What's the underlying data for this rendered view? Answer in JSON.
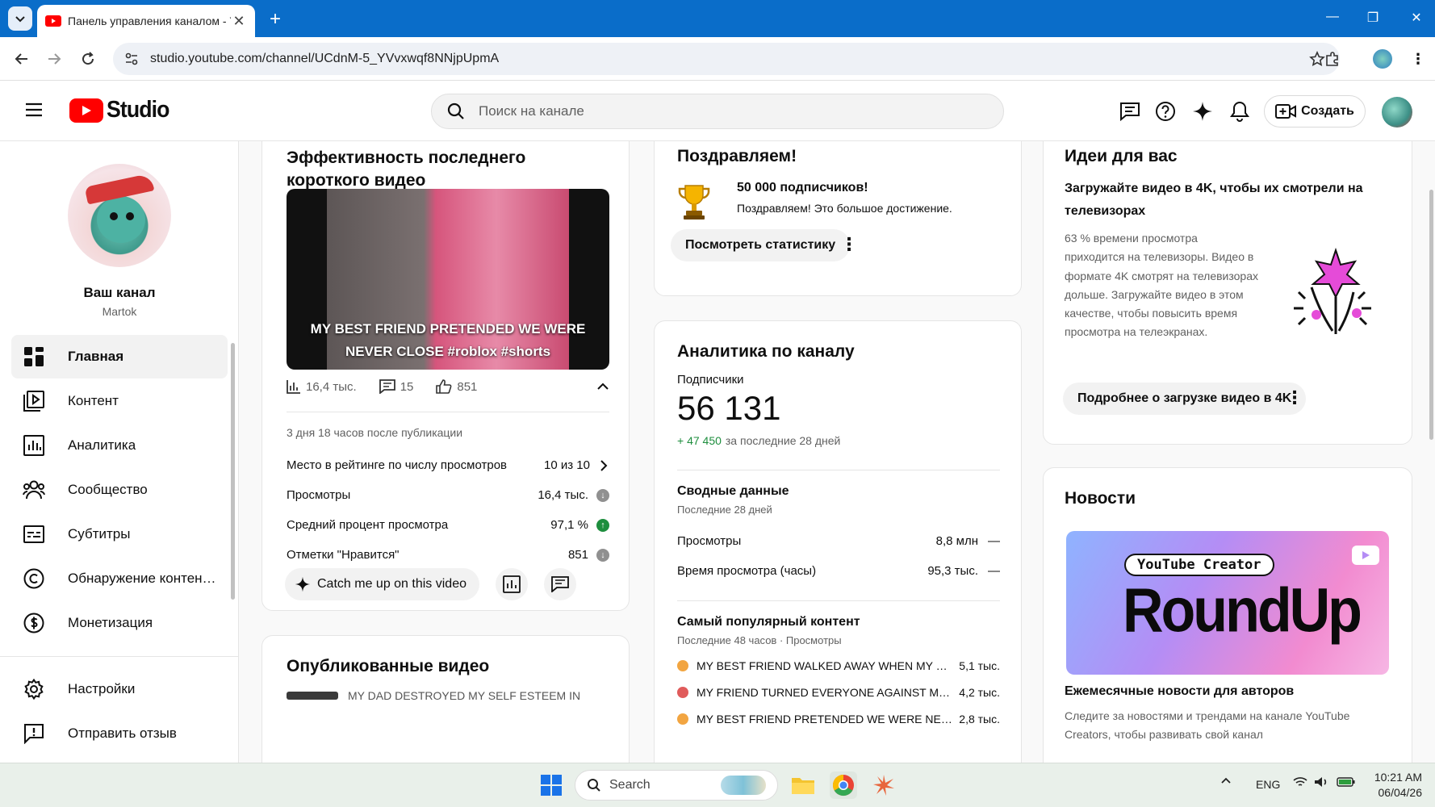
{
  "browser": {
    "tab_title": "Панель управления каналом - YouTube Studio",
    "url": "studio.youtube.com/channel/UCdnM-5_YVvxwqf8NNjpUpmA"
  },
  "header": {
    "logo_text": "Studio",
    "search_placeholder": "Поиск на канале",
    "create_label": "Создать"
  },
  "sidebar": {
    "channel_name": "Ваш канал",
    "channel_handle": "Martok",
    "items": [
      {
        "label": "Главная",
        "icon": "dashboard-icon"
      },
      {
        "label": "Контент",
        "icon": "content-icon"
      },
      {
        "label": "Аналитика",
        "icon": "analytics-icon"
      },
      {
        "label": "Сообщество",
        "icon": "community-icon"
      },
      {
        "label": "Субтитры",
        "icon": "subtitles-icon"
      },
      {
        "label": "Обнаружение контен…",
        "icon": "copyright-icon"
      },
      {
        "label": "Монетизация",
        "icon": "monetization-icon"
      },
      {
        "label": "Настройки",
        "icon": "gear-icon"
      },
      {
        "label": "Отправить отзыв",
        "icon": "feedback-icon"
      }
    ]
  },
  "short_card": {
    "title": "Эффективность последнего короткого видео",
    "video_caption": "MY BEST FRIEND PRETENDED WE WERE NEVER CLOSE #roblox #shorts",
    "views": "16,4 тыс.",
    "comments": "15",
    "likes": "851",
    "since_publish": "3 дня 18 часов после публикации",
    "metrics": [
      {
        "label": "Место в рейтинге по числу просмотров",
        "value": "10 из 10",
        "indicator": "chevron"
      },
      {
        "label": "Просмотры",
        "value": "16,4 тыс.",
        "indicator": "down"
      },
      {
        "label": "Средний процент просмотра",
        "value": "97,1 %",
        "indicator": "up"
      },
      {
        "label": "Отметки \"Нравится\"",
        "value": "851",
        "indicator": "down"
      }
    ],
    "catch_up_label": "Catch me up on this video"
  },
  "published_card": {
    "title": "Опубликованные видео",
    "first_item": "MY DAD DESTROYED MY SELF ESTEEM IN"
  },
  "congrats_card": {
    "title": "Поздравляем!",
    "headline": "50 000 подписчиков!",
    "text": "Поздравляем! Это большое достижение.",
    "button": "Посмотреть статистику"
  },
  "analytics_card": {
    "title": "Аналитика по каналу",
    "subs_label": "Подписчики",
    "subs_value": "56 131",
    "subs_delta": "+ 47 450",
    "subs_period": "за последние 28 дней",
    "summary_title": "Сводные данные",
    "summary_period": "Последние 28 дней",
    "summary_rows": [
      {
        "label": "Просмотры",
        "value": "8,8 млн",
        "trend": "—"
      },
      {
        "label": "Время просмотра (часы)",
        "value": "95,3 тыс.",
        "trend": "—"
      }
    ],
    "top_title": "Самый популярный контент",
    "top_period": "Последние 48 часов · Просмотры",
    "top_rows": [
      {
        "label": "MY BEST FRIEND WALKED AWAY WHEN MY …",
        "value": "5,1 тыс."
      },
      {
        "label": "MY FRIEND TURNED EVERYONE AGAINST M…",
        "value": "4,2 тыс."
      },
      {
        "label": "MY BEST FRIEND PRETENDED WE WERE NE…",
        "value": "2,8 тыс."
      }
    ]
  },
  "ideas_card": {
    "title": "Идеи для вас",
    "headline": "Загружайте видео в 4K, чтобы их смотрели на телевизорах",
    "body": "63 % времени просмотра приходится на телевизоры. Видео в формате 4K смотрят на телевизорах дольше. Загружайте видео в этом качестве, чтобы повысить время просмотра на телеэкранах.",
    "button": "Подробнее о загрузке видео в 4K"
  },
  "news_card": {
    "title": "Новости",
    "banner_badge": "YouTube Creator",
    "banner_title": "RoundUp",
    "headline": "Ежемесячные новости для авторов",
    "text": "Следите за новостями и трендами на канале YouTube Creators, чтобы развивать свой канал"
  },
  "taskbar": {
    "search_label": "Search",
    "lang": "ENG",
    "time": "10:21 AM",
    "date": "06/04/26"
  },
  "colors": {
    "brand_red": "#ff0000",
    "chrome_blue": "#0a6dc9",
    "positive_green": "#1e8e3e"
  }
}
